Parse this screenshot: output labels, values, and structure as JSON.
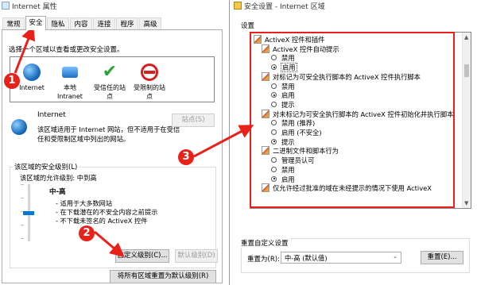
{
  "left_window": {
    "title": "Internet 属性",
    "tabs": [
      "常规",
      "安全",
      "隐私",
      "内容",
      "连接",
      "程序",
      "高级"
    ],
    "active_tab": 1,
    "zone_prompt": "选择一个区域以查看或更改安全设置。",
    "zones": [
      {
        "label": "Internet",
        "icon": "globe-icon"
      },
      {
        "label": "本地\nIntranet",
        "icon": "intranet-icon"
      },
      {
        "label": "受信任的站\n点",
        "icon": "check-icon"
      },
      {
        "label": "受限制的站\n点",
        "icon": "block-icon"
      }
    ],
    "zone_name": "Internet",
    "zone_description": "该区域适用于 Internet 网站，但不适用于在受信任和受限制区域中列出的网站。",
    "sites_button": "站点(S)",
    "level_group_title": "该区域的安全级别(L)",
    "allowed_levels": "该区域的允许级别: 中到高",
    "level_name": "中-高",
    "level_bullets": [
      "- 适用于大多数网站",
      "- 在下载潜在的不安全内容之前提示",
      "- 不下载未签名的 ActiveX 控件"
    ],
    "slider_level": 0.5,
    "custom_level_button": "自定义级别(C)...",
    "default_level_button": "默认级别(D)",
    "reset_all_button": "将所有区域重置为默认级别(R)"
  },
  "right_window": {
    "title": "安全设置 - Internet 区域",
    "settings_label": "设置",
    "settings_tree": [
      {
        "type": "category",
        "text": "ActiveX 控件和插件",
        "indent": 0
      },
      {
        "type": "group",
        "text": "ActiveX 控件自动提示",
        "indent": 1
      },
      {
        "type": "radio",
        "text": "禁用",
        "checked": false,
        "indent": 2
      },
      {
        "type": "radio",
        "text": "启用",
        "checked": true,
        "indent": 2,
        "highlight": true
      },
      {
        "type": "group",
        "text": "对标记为可安全执行脚本的 ActiveX 控件执行脚本",
        "indent": 1
      },
      {
        "type": "radio",
        "text": "禁用",
        "checked": false,
        "indent": 2
      },
      {
        "type": "radio",
        "text": "启用",
        "checked": true,
        "indent": 2
      },
      {
        "type": "radio",
        "text": "提示",
        "checked": false,
        "indent": 2
      },
      {
        "type": "group",
        "text": "对未标记为可安全执行脚本的 ActiveX 控件初始化并执行脚本",
        "indent": 1
      },
      {
        "type": "radio",
        "text": "禁用 (推荐)",
        "checked": false,
        "indent": 2
      },
      {
        "type": "radio",
        "text": "启用 (不安全)",
        "checked": false,
        "indent": 2
      },
      {
        "type": "radio",
        "text": "提示",
        "checked": true,
        "indent": 2
      },
      {
        "type": "group",
        "text": "二进制文件和脚本行为",
        "indent": 1
      },
      {
        "type": "radio",
        "text": "管理员认可",
        "checked": false,
        "indent": 2
      },
      {
        "type": "radio",
        "text": "禁用",
        "checked": false,
        "indent": 2
      },
      {
        "type": "radio",
        "text": "启用",
        "checked": true,
        "indent": 2
      },
      {
        "type": "group",
        "text": "仅允许经过批准的域在未经提示的情况下使用 ActiveX",
        "indent": 1
      }
    ],
    "reset_group_title": "重置自定义设置",
    "reset_to_label": "重置为(R):",
    "reset_select_value": "中-高 (默认值)",
    "reset_button": "重置(E)..."
  },
  "annotations": [
    "1",
    "2",
    "3"
  ],
  "colors": {
    "annotation": "#e8211b",
    "highlight": "#0078d7"
  }
}
